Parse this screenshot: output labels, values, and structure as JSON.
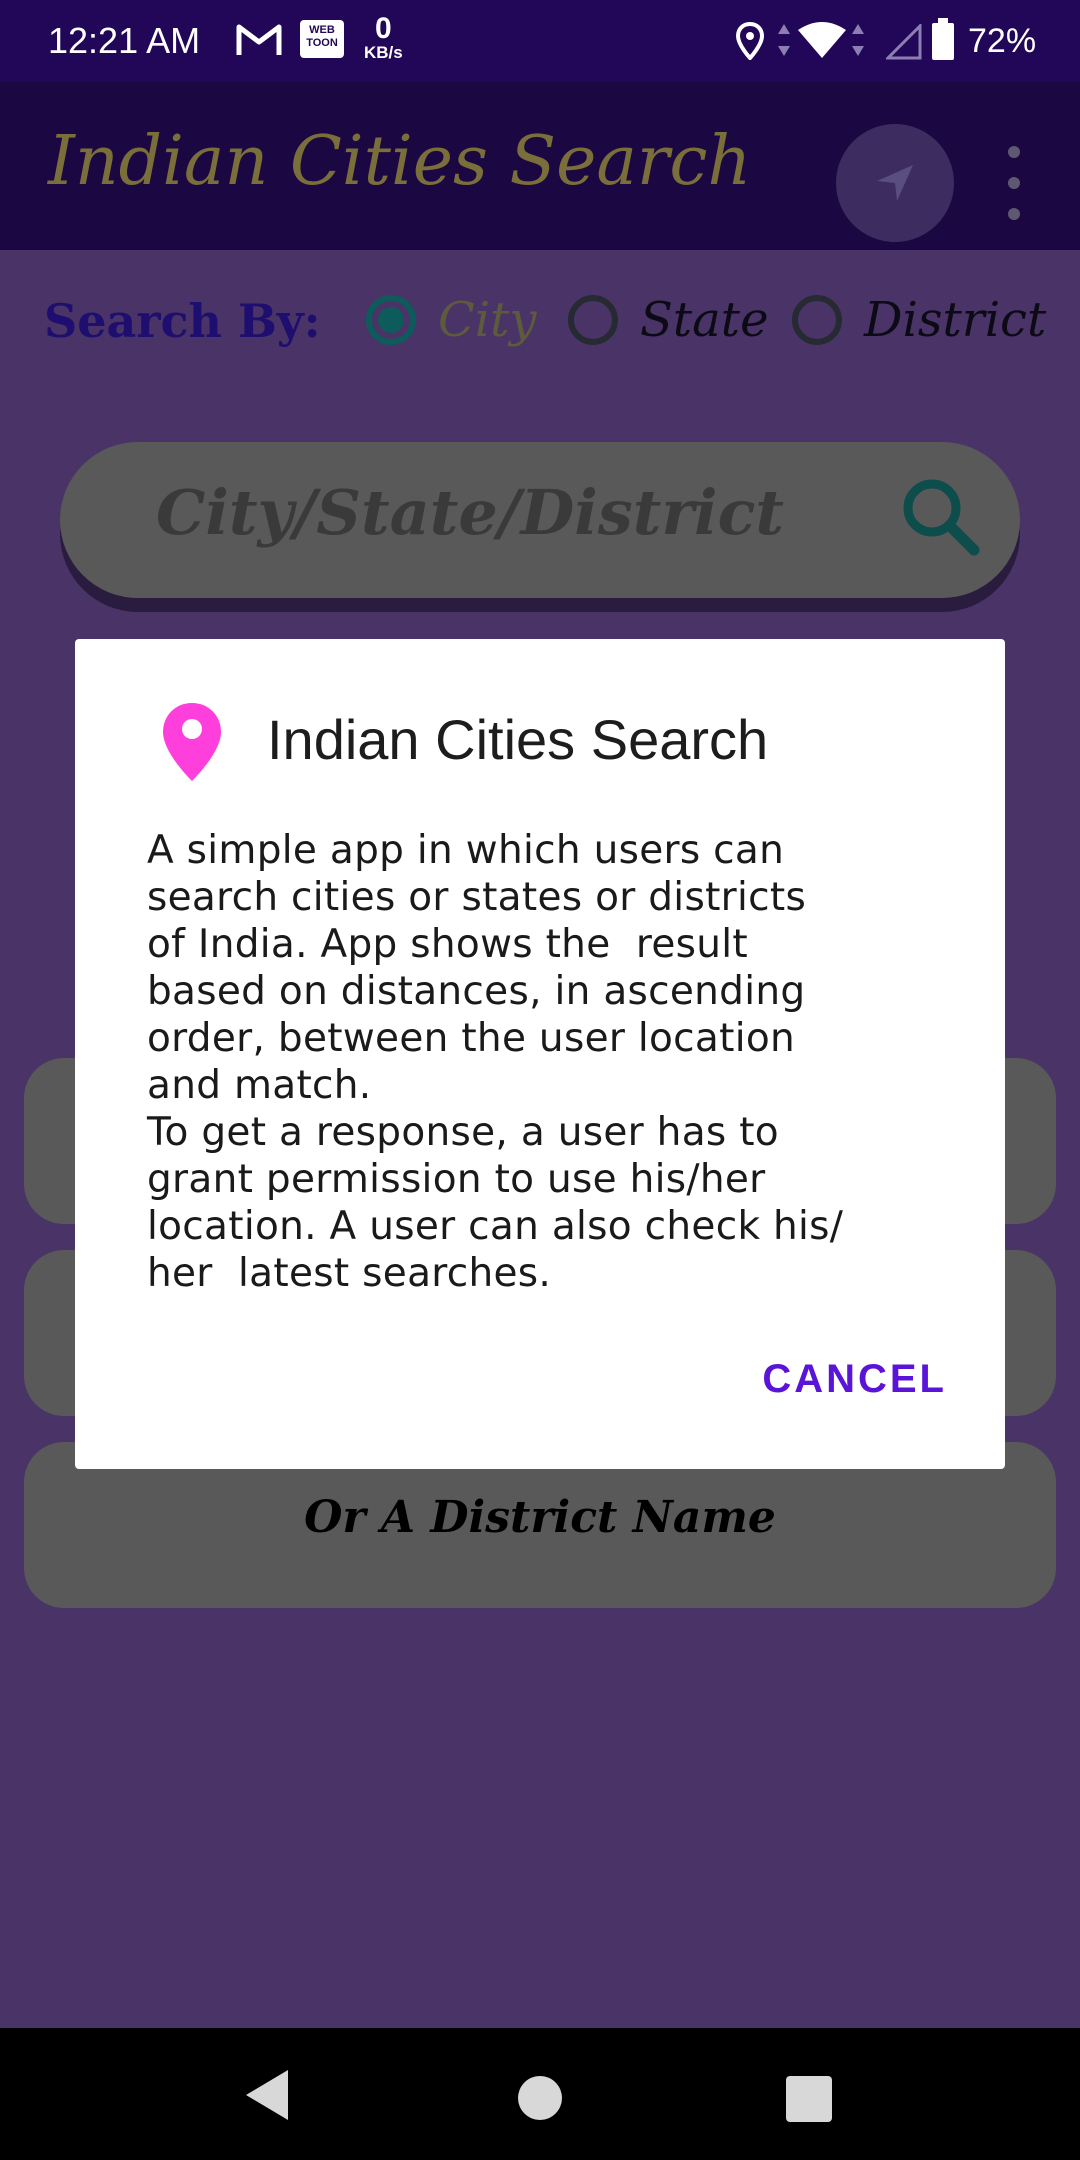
{
  "status_bar": {
    "time": "12:21 AM",
    "webtoon_label": "WEB TOON",
    "net_speed_value": "0",
    "net_speed_unit": "KB/s",
    "battery": "72%",
    "icons": [
      "gmail-icon",
      "webtoon-icon",
      "location-icon",
      "wifi-icon",
      "signal-icon",
      "battery-icon"
    ]
  },
  "toolbar": {
    "title": "Indian Cities Search",
    "nav_icon": "navigation-arrow-icon",
    "menu_icon": "more-vert-icon"
  },
  "search_by": {
    "label": "Search By:",
    "options": [
      {
        "label": "City",
        "checked": true
      },
      {
        "label": "State",
        "checked": false
      },
      {
        "label": "District",
        "checked": false
      }
    ]
  },
  "search": {
    "placeholder": "City/State/District"
  },
  "cards": [
    {
      "text": ""
    },
    {
      "text": ""
    },
    {
      "text": "Or A District Name"
    }
  ],
  "dialog": {
    "title": "Indian Cities Search",
    "message": "A simple app in which users can\nsearch cities or states or districts\nof India. App shows the  result\nbased on distances, in ascending\norder, between the user location\nand match.\nTo get a response, a user has to\ngrant permission to use his/her\nlocation. A user can also check his/\nher  latest searches.",
    "cancel_label": "CANCEL",
    "icon": "location-pin-icon"
  },
  "colors": {
    "status_bar": "#220657",
    "toolbar": "#1b0842",
    "background": "#4a3366",
    "accent": "#5a14d8",
    "pin": "#ff3fdc"
  }
}
